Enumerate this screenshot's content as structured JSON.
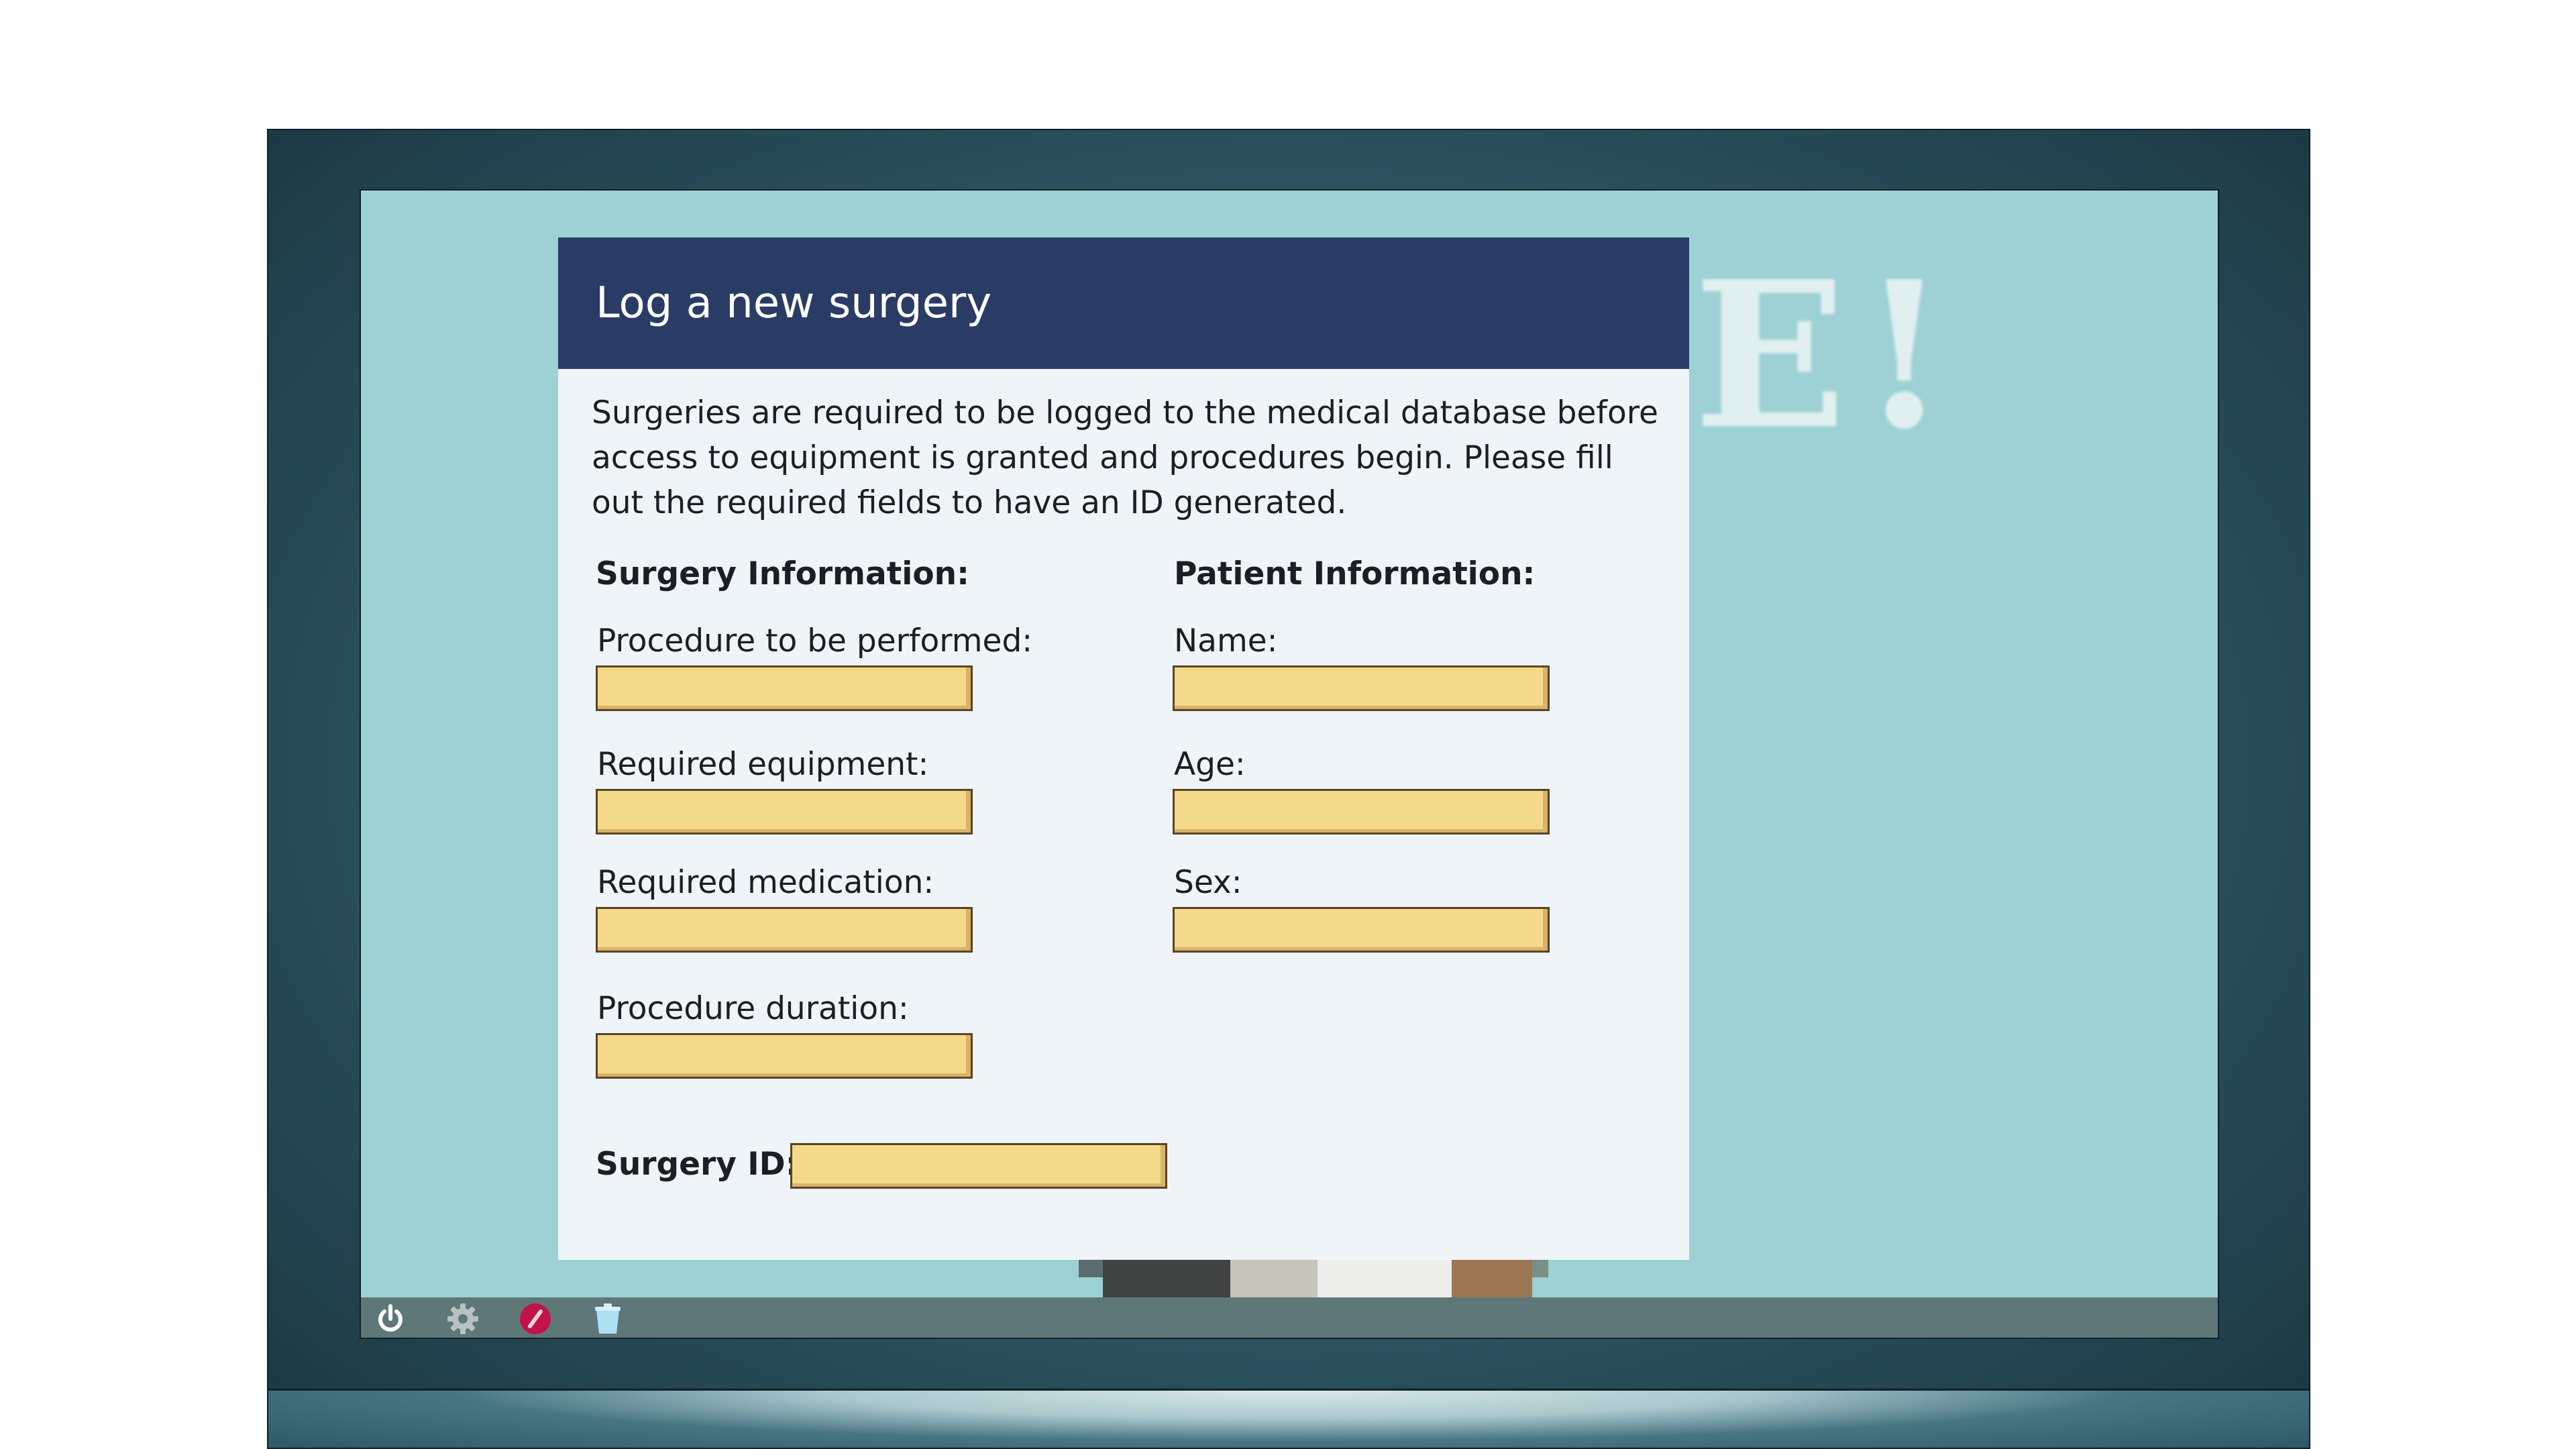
{
  "dialog": {
    "title": "Log a new surgery",
    "intro": "Surgeries are required to be logged to the medical database before access to equipment is granted and procedures begin. Please fill out the required fields to have an ID generated.",
    "surgery_section": {
      "heading": "Surgery Information:",
      "fields": [
        {
          "label": "Procedure to be performed:",
          "value": ""
        },
        {
          "label": "Required equipment:",
          "value": ""
        },
        {
          "label": "Required medication:",
          "value": ""
        },
        {
          "label": "Procedure duration:",
          "value": ""
        }
      ]
    },
    "patient_section": {
      "heading": "Patient Information:",
      "fields": [
        {
          "label": "Name:",
          "value": ""
        },
        {
          "label": "Age:",
          "value": ""
        },
        {
          "label": "Sex:",
          "value": ""
        }
      ]
    },
    "surgery_id": {
      "label": "Surgery ID:",
      "value": ""
    }
  },
  "wallpaper": {
    "letters": "E!"
  },
  "taskbar": {
    "icons": [
      "power-icon",
      "gear-icon",
      "no-entry-icon",
      "trash-icon"
    ]
  },
  "colors": {
    "header": "#2a3c66",
    "screen": "#9dd1d3",
    "input": "#f5d98b",
    "taskbar": "#5f7779"
  }
}
